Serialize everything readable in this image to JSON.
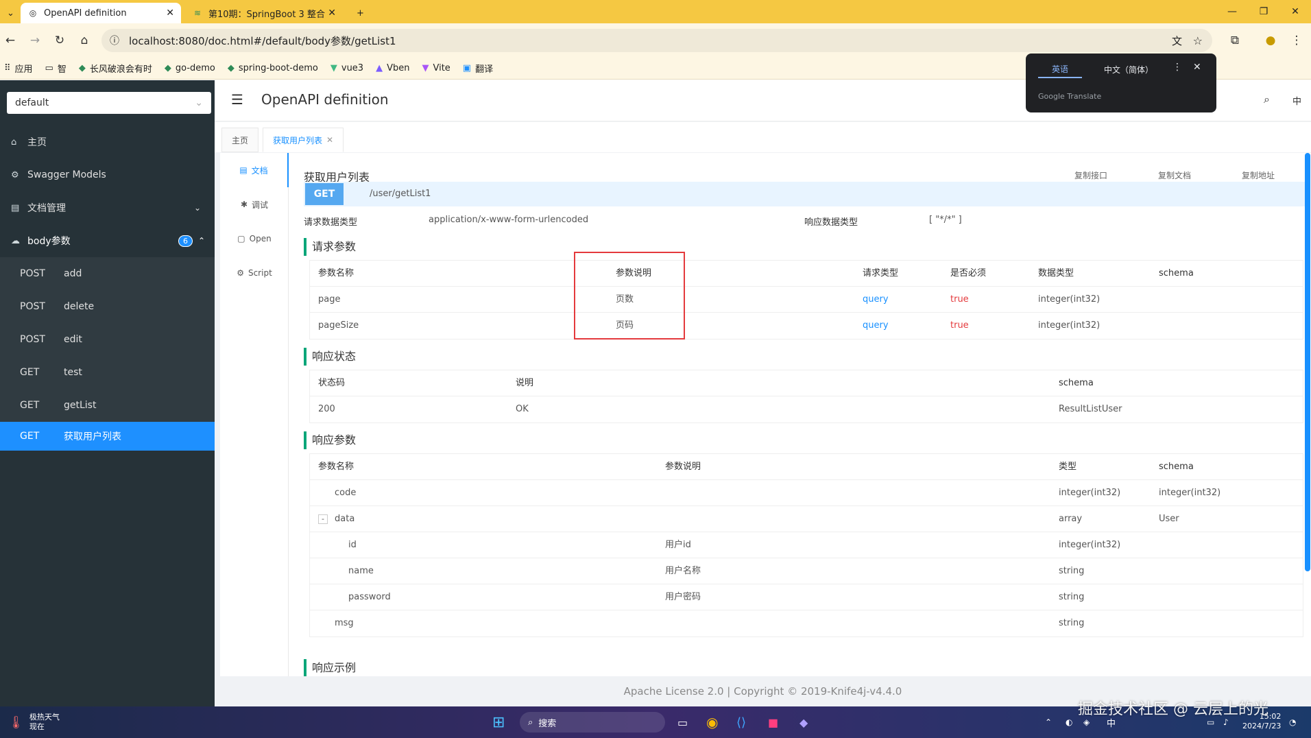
{
  "browser": {
    "tabs": [
      {
        "title": "OpenAPI definition"
      },
      {
        "title": "第10期：SpringBoot 3 整合..."
      }
    ],
    "url": "localhost:8080/doc.html#/default/body参数/getList1",
    "bookmarks": [
      "应用",
      "智",
      "长风破浪会有时",
      "go-demo",
      "spring-boot-demo",
      "vue3",
      "Vben",
      "Vite",
      "翻译"
    ]
  },
  "translate_popup": {
    "tab_source": "英语",
    "tab_target": "中文（简体）",
    "brand": "Google Translate"
  },
  "sidebar": {
    "group": "default",
    "menu": [
      {
        "label": "主页",
        "icon": "home-icon"
      },
      {
        "label": "Swagger Models",
        "icon": "gear-icon"
      },
      {
        "label": "文档管理",
        "icon": "doc-icon"
      },
      {
        "label": "body参数",
        "icon": "cloud-icon",
        "badge": "6"
      }
    ],
    "items": [
      {
        "method": "POST",
        "name": "add"
      },
      {
        "method": "POST",
        "name": "delete"
      },
      {
        "method": "POST",
        "name": "edit"
      },
      {
        "method": "GET",
        "name": "test"
      },
      {
        "method": "GET",
        "name": "getList"
      },
      {
        "method": "GET",
        "name": "获取用户列表"
      }
    ]
  },
  "header": {
    "title": "OpenAPI definition",
    "lang": "中"
  },
  "page_tabs": [
    "主页",
    "获取用户列表"
  ],
  "side_tabs": [
    "文档",
    "调试",
    "Open",
    "Script"
  ],
  "doc": {
    "title": "获取用户列表",
    "actions": [
      "复制接口",
      "复制文档",
      "复制地址"
    ],
    "method": "GET",
    "path": "/user/getList1",
    "req_type_label": "请求数据类型",
    "req_type": "application/x-www-form-urlencoded",
    "resp_type_label": "响应数据类型",
    "resp_type": "[ \"*/*\" ]",
    "req_params_title": "请求参数",
    "req_headers": [
      "参数名称",
      "参数说明",
      "请求类型",
      "是否必须",
      "数据类型",
      "schema"
    ],
    "req_rows": [
      [
        "page",
        "页数",
        "query",
        "true",
        "integer(int32)",
        ""
      ],
      [
        "pageSize",
        "页码",
        "query",
        "true",
        "integer(int32)",
        ""
      ]
    ],
    "status_title": "响应状态",
    "status_headers": [
      "状态码",
      "说明",
      "schema"
    ],
    "status_rows": [
      [
        "200",
        "OK",
        "ResultListUser"
      ]
    ],
    "resp_params_title": "响应参数",
    "resp_headers": [
      "参数名称",
      "参数说明",
      "类型",
      "schema"
    ],
    "resp_rows": [
      [
        "code",
        "",
        "integer(int32)",
        "integer(int32)"
      ],
      [
        "data",
        "",
        "array",
        "User"
      ],
      [
        "id",
        "用户id",
        "integer(int32)",
        ""
      ],
      [
        "name",
        "用户名称",
        "string",
        ""
      ],
      [
        "password",
        "用户密码",
        "string",
        ""
      ],
      [
        "msg",
        "",
        "string",
        ""
      ]
    ],
    "example_title": "响应示例"
  },
  "footer": "Apache License 2.0 | Copyright © 2019-Knife4j-v4.4.0",
  "taskbar": {
    "weather_title": "极热天气",
    "weather_sub": "现在",
    "search": "搜索",
    "ime": "中",
    "time": "15:02",
    "date": "2024/7/23",
    "watermark": "掘金技术社区 @ 云层上的光"
  },
  "colors": {
    "accent": "#1890ff",
    "sidebar": "#263238",
    "active": "#1e90ff",
    "section": "#0aa679",
    "highlight": "#e4393c"
  }
}
